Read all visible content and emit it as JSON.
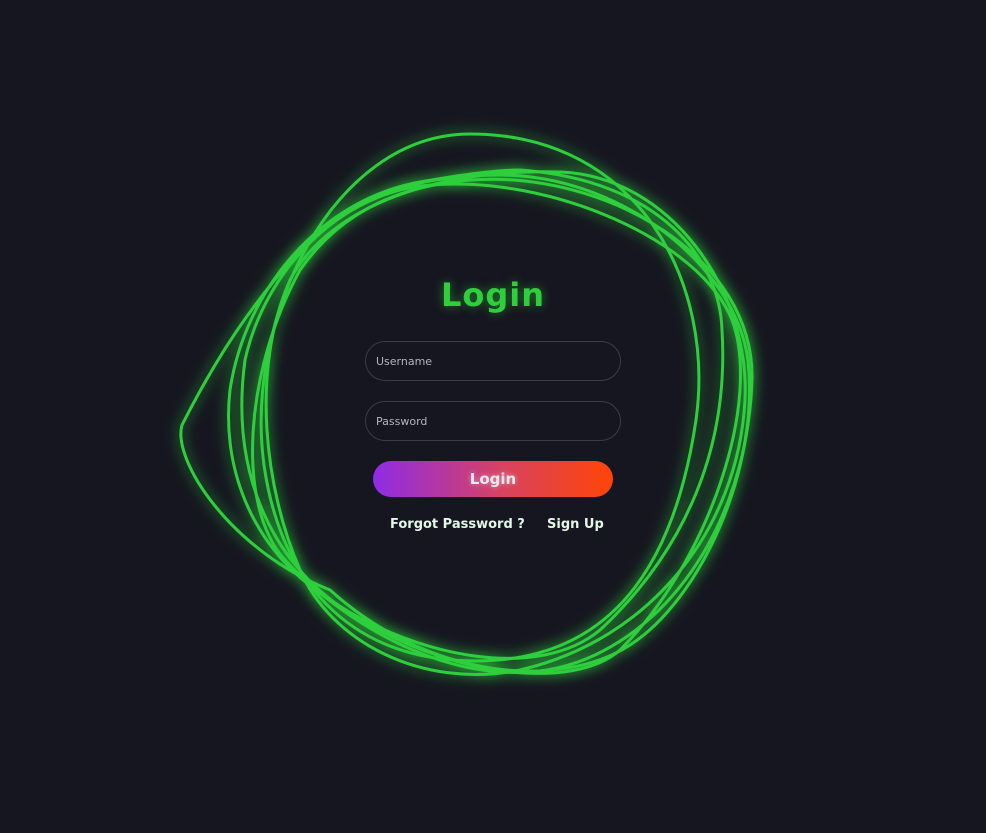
{
  "form": {
    "title": "Login",
    "username_placeholder": "Username",
    "password_placeholder": "Password",
    "submit_label": "Login",
    "forgot_password_label": "Forgot Password ?",
    "sign_up_label": "Sign Up"
  },
  "theme": {
    "background": "#161620",
    "ring_color": "#2fcf3c",
    "button_gradient_start": "#8f2be6",
    "button_gradient_end": "#ff4406"
  }
}
